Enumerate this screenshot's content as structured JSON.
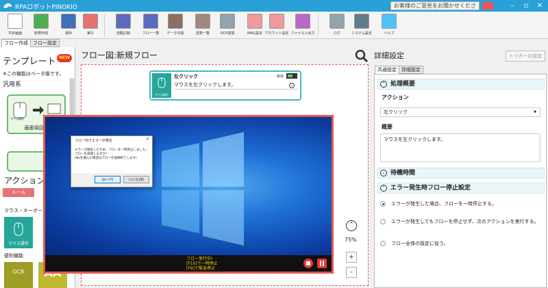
{
  "app": {
    "title": "RPAロボットPINOKIO",
    "feedback": "お客様のご意見をお聞かせください"
  },
  "window": {
    "minimize": "–",
    "maximize": "▫",
    "close": "✕"
  },
  "toolbar": [
    {
      "label": "TOP画面",
      "icon": "home-icon",
      "color": "#ffffff"
    },
    {
      "label": "新規作成",
      "icon": "new-file-icon",
      "color": "#4caf50"
    },
    {
      "label": "保存",
      "icon": "save-icon",
      "color": "#3f6fb5"
    },
    {
      "label": "実行",
      "icon": "play-icon",
      "color": "#e57373"
    },
    {
      "label": "自動記録",
      "icon": "record-icon",
      "color": "#5c6bc0"
    },
    {
      "label": "フロー一覧",
      "icon": "list-icon",
      "color": "#5c6bc0"
    },
    {
      "label": "データ交換",
      "icon": "data-icon",
      "color": "#8d6e63"
    },
    {
      "label": "変数一覧",
      "icon": "box-icon",
      "color": "#a1887f"
    },
    {
      "label": "OCR変換",
      "icon": "ocr-icon",
      "color": "#90a4ae"
    },
    {
      "label": "MAIL設定",
      "icon": "mail-icon",
      "color": "#ef9a9a"
    },
    {
      "label": "アカウント設定",
      "icon": "account-icon",
      "color": "#ef9a9a"
    },
    {
      "label": "ファイル入出力",
      "icon": "file-io-icon",
      "color": "#ba68c8"
    },
    {
      "label": "ログ",
      "icon": "log-icon",
      "color": "#90a4ae"
    },
    {
      "label": "システム設定",
      "icon": "gear-icon",
      "color": "#607d8b"
    },
    {
      "label": "ヘルプ",
      "icon": "help-icon",
      "color": "#4fc3f7"
    }
  ],
  "left": {
    "tabs": [
      "フロー作成",
      "フロー設定"
    ],
    "template_title": "テンプレート",
    "new_badge": "NEW",
    "beta_note": "※この機能はベータ版です。",
    "category_general": "汎用系",
    "card_caption": "画面項目に",
    "card_icon_label": "マウス操作",
    "actions_title": "アクション",
    "mail": "メール",
    "mouse_keyboard": "マウス・キーボー",
    "mouse_op": "マウス操作",
    "convenience": "便利機能",
    "ocr": "OCR",
    "aa": "AA"
  },
  "flow": {
    "title": "フロー図:新規フロー",
    "node": {
      "title": "左クリック",
      "enabled": "有効",
      "desc": "マウスを左クリックします。",
      "icon_label": "マウス操作"
    },
    "zoom": "75%",
    "zoom_up": "⌃",
    "zoom_in": "+",
    "zoom_out": "-"
  },
  "overlay": {
    "dialog": {
      "title": "フロー内でエラーが発生",
      "close": "✕",
      "lines": [
        "エラーが発生したため、フローを一時停止しました。",
        "フローを再開しますか?",
        "(Noを選んだ場合はフローを強制終了します)"
      ],
      "yes": "はい(Y)",
      "no": "いいえ(N)"
    },
    "status": [
      "フロー実行中!",
      "[F10]で一時停止",
      "[F9]で緊急停止"
    ]
  },
  "right": {
    "title": "詳細設定",
    "trigger": "トリガーの設定",
    "tabs": [
      "共通設定",
      "詳細設定"
    ],
    "section_overview": "処理概要",
    "action_label": "アクション",
    "action_value": "左クリック",
    "summary_label": "概要",
    "summary_value": "マウスを左クリックします。",
    "section_wait": "待機時間",
    "section_error": "エラー発生時フロー停止設定",
    "radios": [
      "エラーが発生した場合、フローを一時停止する。",
      "エラーが発生してもフローを停止せず、次のアクションを実行する。",
      "フロー全体の設定に従う。"
    ],
    "selected_radio": 0
  }
}
